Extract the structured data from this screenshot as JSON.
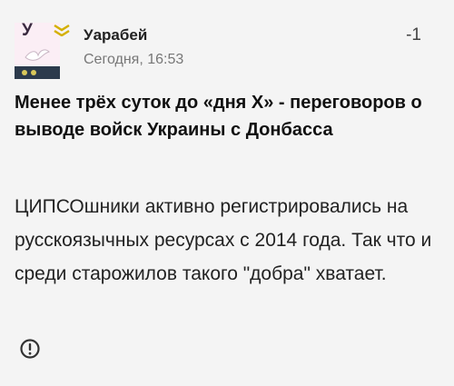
{
  "post": {
    "avatar": {
      "letter": "У"
    },
    "author": "Уарабей",
    "timestamp": "Сегодня, 16:53",
    "score": "-1",
    "title": "Менее трёх суток до «дня Х» - переговоров о выводе войск Украины с Донбасса",
    "body": "ЦИПСОшники активно регистрировались на русскоязычных ресурсах с 2014 года. Так что и среди старожилов такого \"добра\" хватает.",
    "report_icon": "exclamation-circle-icon"
  },
  "colors": {
    "background": "#f4f4f4",
    "text": "#1a1a1a",
    "muted": "#777777",
    "rank_badge": "#d4b000"
  }
}
